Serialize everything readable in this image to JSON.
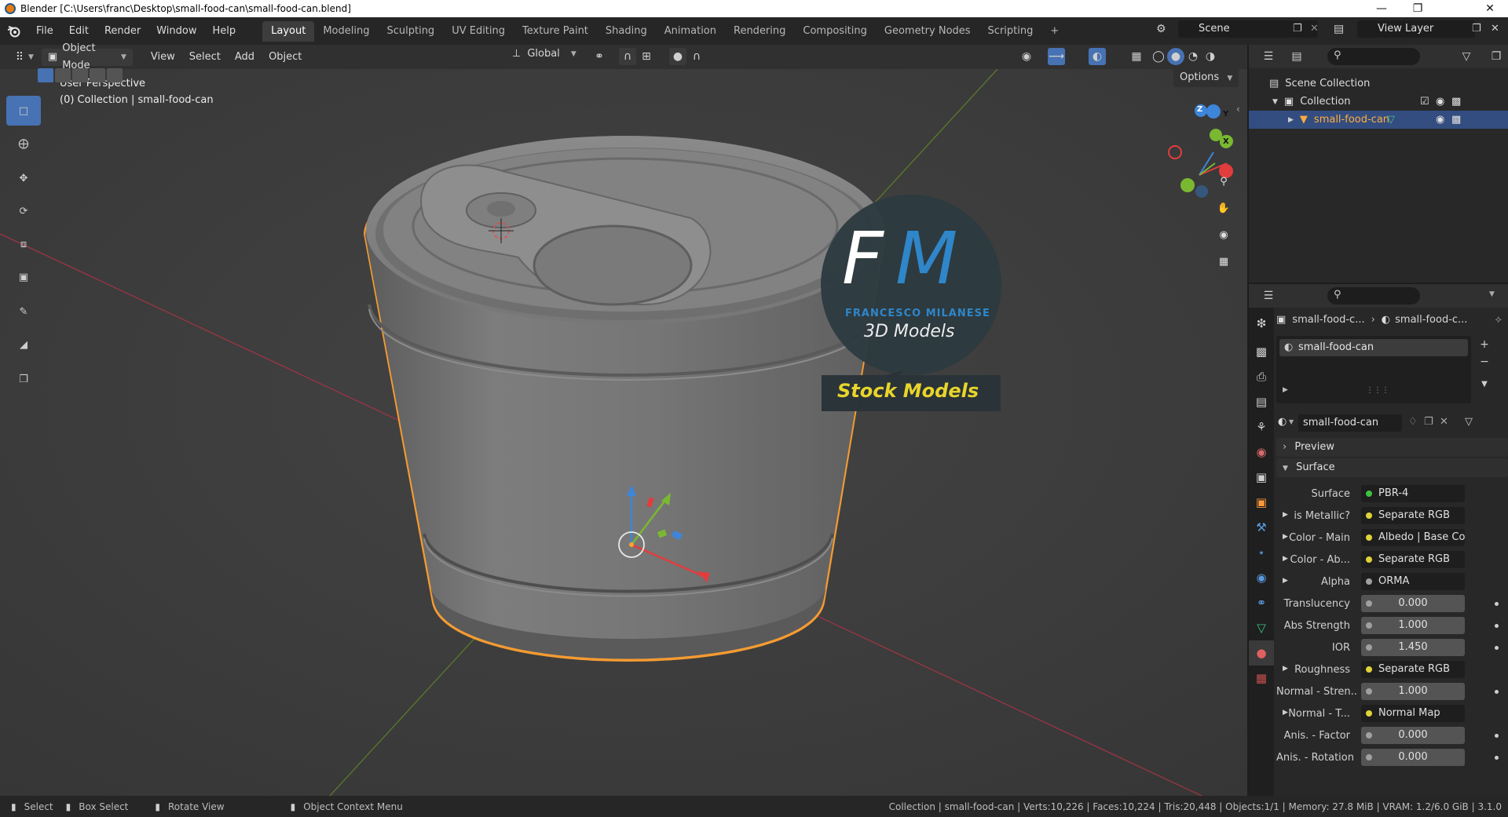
{
  "titlebar": {
    "title": "Blender [C:\\Users\\franc\\Desktop\\small-food-can\\small-food-can.blend]"
  },
  "topbar": {
    "menus": [
      "File",
      "Edit",
      "Render",
      "Window",
      "Help"
    ],
    "workspaces": [
      "Layout",
      "Modeling",
      "Sculpting",
      "UV Editing",
      "Texture Paint",
      "Shading",
      "Animation",
      "Rendering",
      "Compositing",
      "Geometry Nodes",
      "Scripting"
    ],
    "add_tab": "+",
    "scene": "Scene",
    "view_layer": "View Layer"
  },
  "viewport_header": {
    "mode": "Object Mode",
    "menus": [
      "View",
      "Select",
      "Add",
      "Object"
    ],
    "transform_orientation": "Global",
    "options_label": "Options"
  },
  "viewport": {
    "perspective": "User Perspective",
    "collection_info": "(0) Collection | small-food-can",
    "watermark": {
      "monogram_f": "F",
      "monogram_m": "M",
      "author": "FRANCESCO MILANESE",
      "subtitle": "3D Models",
      "banner": "Stock Models"
    },
    "gizmo_axes": [
      "X",
      "Y",
      "Z"
    ]
  },
  "outliner": {
    "rows": [
      {
        "label": "Scene Collection"
      },
      {
        "label": "Collection"
      },
      {
        "label": "small-food-can"
      }
    ]
  },
  "properties": {
    "breadcrumb_object": "small-food-c...",
    "breadcrumb_material": "small-food-c...",
    "material_slot": "small-food-can",
    "material_name": "small-food-can",
    "panels": {
      "preview": "Preview",
      "surface": "Surface"
    },
    "rows": [
      {
        "label": "Surface",
        "value": "PBR-4",
        "socket_color": "#3cc33c",
        "expandable": false,
        "numeric": false
      },
      {
        "label": "is Metallic?",
        "value": "Separate RGB",
        "socket_color": "#e0d23a",
        "expandable": true,
        "numeric": false
      },
      {
        "label": "Color - Main",
        "value": "Albedo | Base Color",
        "socket_color": "#e0d23a",
        "expandable": true,
        "numeric": false
      },
      {
        "label": "Color - Ab...",
        "value": "Separate RGB",
        "socket_color": "#e0d23a",
        "expandable": true,
        "numeric": false
      },
      {
        "label": "Alpha",
        "value": "ORMA",
        "socket_color": "#a0a0a0",
        "expandable": true,
        "numeric": false
      },
      {
        "label": "Translucency",
        "value": "0.000",
        "socket_color": "#a0a0a0",
        "expandable": false,
        "numeric": true
      },
      {
        "label": "Abs Strength",
        "value": "1.000",
        "socket_color": "#a0a0a0",
        "expandable": false,
        "numeric": true
      },
      {
        "label": "IOR",
        "value": "1.450",
        "socket_color": "#a0a0a0",
        "expandable": false,
        "numeric": true
      },
      {
        "label": "Roughness",
        "value": "Separate RGB",
        "socket_color": "#e0d23a",
        "expandable": true,
        "numeric": false
      },
      {
        "label": "Normal - Stren...",
        "value": "1.000",
        "socket_color": "#a0a0a0",
        "expandable": false,
        "numeric": true
      },
      {
        "label": "Normal - T...",
        "value": "Normal Map",
        "socket_color": "#e0d23a",
        "expandable": true,
        "numeric": false
      },
      {
        "label": "Anis. - Factor",
        "value": "0.000",
        "socket_color": "#a0a0a0",
        "expandable": false,
        "numeric": true
      },
      {
        "label": "Anis. - Rotation",
        "value": "0.000",
        "socket_color": "#a0a0a0",
        "expandable": false,
        "numeric": true
      }
    ]
  },
  "statusbar": {
    "select": "Select",
    "box_select": "Box Select",
    "rotate_view": "Rotate View",
    "context_menu": "Object Context Menu",
    "stats": "Collection | small-food-can | Verts:10,226 | Faces:10,224 | Tris:20,448 | Objects:1/1 | Memory: 27.8 MiB | VRAM: 1.2/6.0 GiB | 3.1.0"
  },
  "colors": {
    "accent_blue": "#4772b3",
    "selection_orange": "#ffa030",
    "watermark_yellow": "#e8d52a",
    "watermark_blue": "#2f86c9"
  }
}
